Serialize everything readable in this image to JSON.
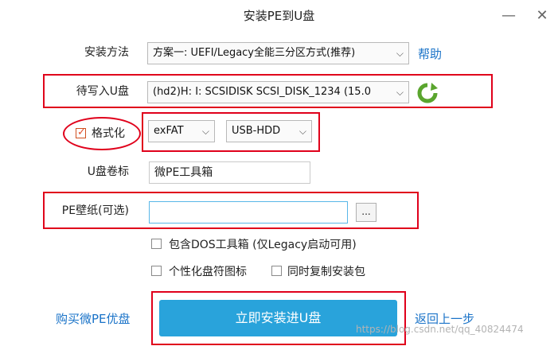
{
  "window": {
    "title": "安装PE到U盘",
    "minimize_glyph": "—",
    "close_glyph": "✕"
  },
  "form": {
    "install_method": {
      "label": "安装方法",
      "value": "方案一: UEFI/Legacy全能三分区方式(推荐)",
      "help_link": "帮助"
    },
    "target_disk": {
      "label": "待写入U盘",
      "value": "(hd2)H: I: SCSIDISK SCSI_DISK_1234 (15.0",
      "refresh_icon": "refresh-icon"
    },
    "format": {
      "label": "格式化",
      "checked": true,
      "filesystem": "exFAT",
      "mode": "USB-HDD"
    },
    "volume_label": {
      "label": "U盘卷标",
      "value": "微PE工具箱"
    },
    "wallpaper": {
      "label": "PE壁纸(可选)",
      "value": "",
      "browse_label": "..."
    },
    "options": {
      "include_dos": "包含DOS工具箱 (仅Legacy启动可用)",
      "personalize_icon": "个性化盘符图标",
      "copy_installer": "同时复制安装包"
    }
  },
  "footer": {
    "buy_link": "购买微PE优盘",
    "install_button": "立即安装进U盘",
    "back_link": "返回上一步",
    "watermark": "https://blog.csdn.net/qq_40824474"
  },
  "colors": {
    "accent": "#29a3db",
    "link": "#1a73c8",
    "highlight": "#e0001b",
    "refresh": "#5aa52e"
  }
}
